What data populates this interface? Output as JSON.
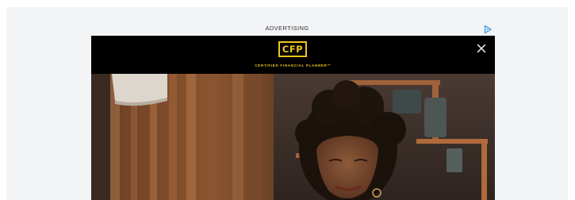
{
  "ad": {
    "label": "ADVERTISING",
    "adchoices_icon": "adchoices-icon",
    "close_icon": "close-icon"
  },
  "brand": {
    "logo_text": "CFP",
    "tagline": "CERTIFIED FINANCIAL PLANNER™",
    "accent_color": "#f2c519",
    "background_color": "#000000"
  },
  "colors": {
    "page_background": "#ffffff",
    "ad_area_background": "#f3f4f6",
    "adchoices_color": "#4aa3df"
  }
}
